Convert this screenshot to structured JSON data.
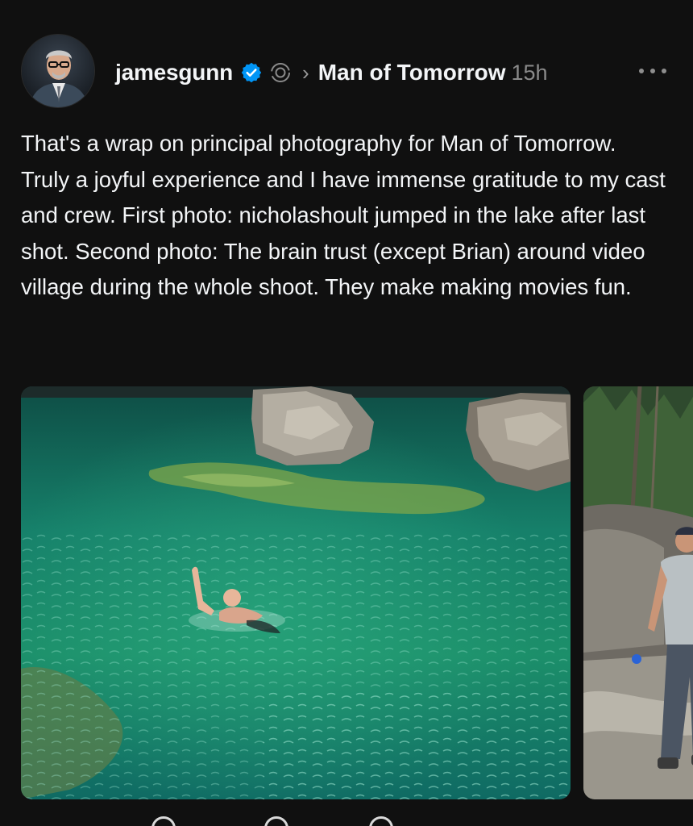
{
  "post": {
    "author": {
      "username": "jamesgunn",
      "verified": true
    },
    "community": "Man of Tomorrow",
    "timestamp": "15h",
    "caption": "That's a wrap on principal photography for Man of Tomorrow. Truly a joyful experience and I have immense gratitude to my cast and crew. First photo: nicholashoult jumped in the lake after last shot. Second photo: The brain trust (except Brian) around video village during the whole shoot. They make making movies fun.",
    "media": {
      "count": 2
    }
  },
  "icons": {
    "verified": "verified-badge-icon",
    "community": "community-icon",
    "separator": "chevron-right-icon",
    "more": "more-horizontal-icon"
  },
  "colors": {
    "background": "#101010",
    "text_primary": "#f3f5f7",
    "text_secondary": "#8a8a8a",
    "verified_blue": "#0095f6",
    "water_green": "#1f8a63"
  }
}
